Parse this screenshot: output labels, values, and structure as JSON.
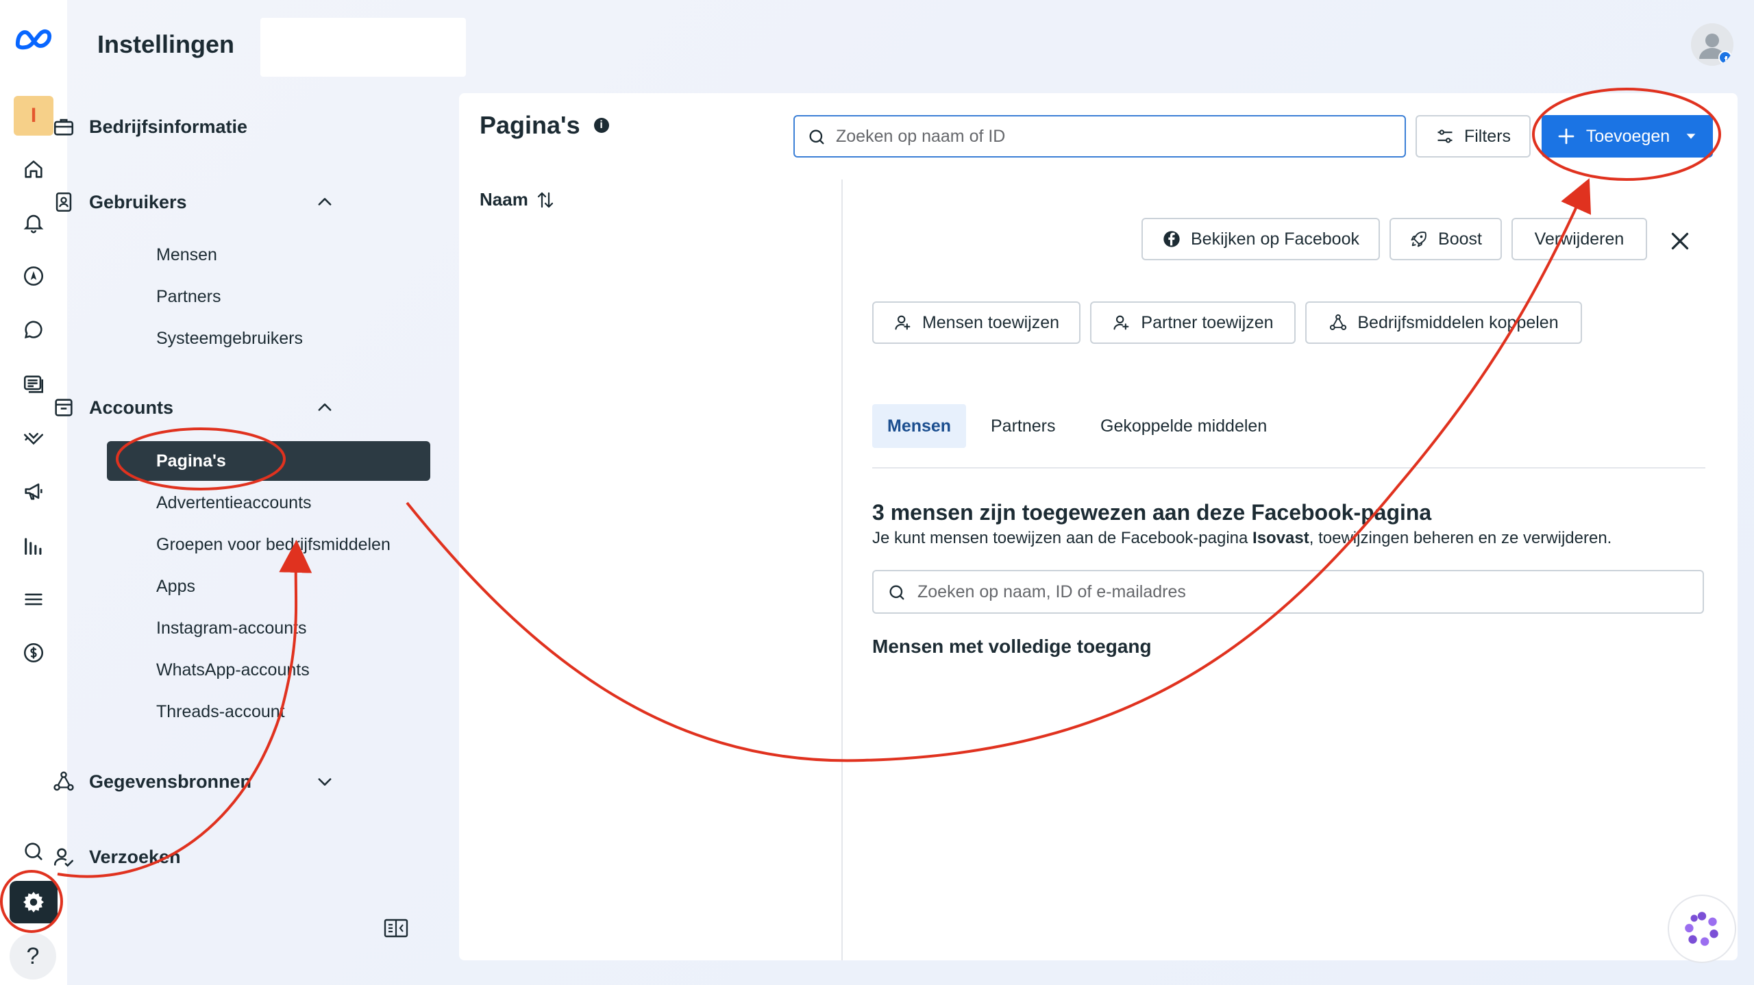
{
  "header": {
    "title": "Instellingen"
  },
  "rail": {
    "avatar_letter": "I",
    "help_label": "?",
    "icons": [
      "meta-logo-icon",
      "home-icon",
      "bell-icon",
      "compass-icon",
      "chat-icon",
      "content-icon",
      "handshake-icon",
      "megaphone-icon",
      "chart-icon",
      "menu-icon",
      "dollar-icon",
      "search-icon",
      "gear-icon",
      "help-icon"
    ]
  },
  "sidebar": {
    "sections": [
      {
        "label": "Bedrijfsinformatie"
      },
      {
        "label": "Gebruikers",
        "items": [
          "Mensen",
          "Partners",
          "Systeemgebruikers"
        ]
      },
      {
        "label": "Accounts",
        "items": [
          "Pagina's",
          "Advertentieaccounts",
          "Groepen voor bedrijfsmiddelen",
          "Apps",
          "Instagram-accounts",
          "WhatsApp-accounts",
          "Threads-account"
        ]
      },
      {
        "label": "Gegevensbronnen"
      },
      {
        "label": "Verzoeken"
      }
    ]
  },
  "main": {
    "title": "Pagina's",
    "info_label": "i",
    "search_placeholder": "Zoeken op naam of ID",
    "filters_label": "Filters",
    "add_label": "Toevoegen",
    "name_column": "Naam",
    "actions": {
      "view_facebook": "Bekijken op Facebook",
      "boost": "Boost",
      "remove": "Verwijderen",
      "assign_people": "Mensen toewijzen",
      "assign_partner": "Partner toewijzen",
      "link_assets": "Bedrijfsmiddelen koppelen"
    },
    "tabs": [
      "Mensen",
      "Partners",
      "Gekoppelde middelen"
    ],
    "heading": "3 mensen zijn toegewezen aan deze Facebook-pagina",
    "subtext_prefix": "Je kunt mensen toewijzen aan de Facebook-pagina ",
    "subtext_page": "Isovast",
    "subtext_suffix": ", toewijzingen beheren en ze verwijderen.",
    "people_search_placeholder": "Zoeken op naam, ID of e-mailadres",
    "full_access_heading": "Mensen met volledige toegang"
  },
  "colors": {
    "primary": "#1b74e4",
    "annotation": "#e0321f",
    "active_nav": "#2c3a43"
  }
}
